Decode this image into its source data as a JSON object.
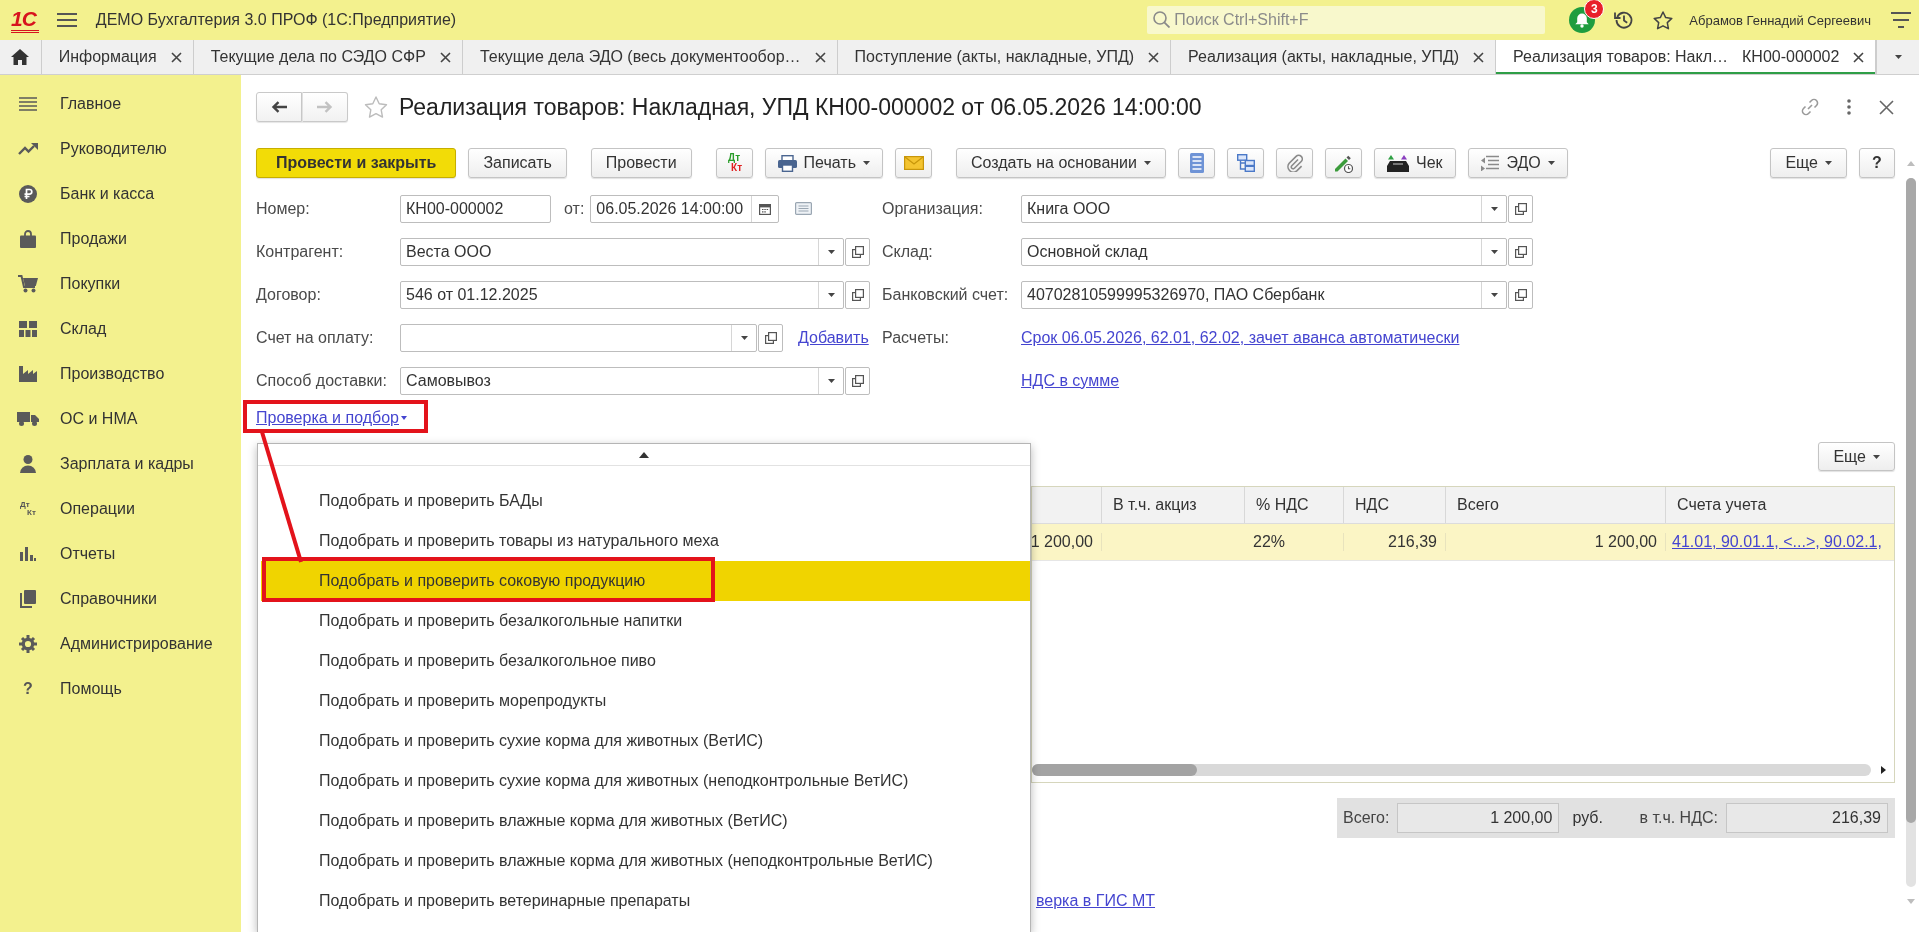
{
  "app_bar": {
    "logo": "1С",
    "title": "ДЕМО Бухгалтерия 3.0 ПРОФ (1С:Предприятие)",
    "search": {
      "placeholder": "Поиск Ctrl+Shift+F"
    },
    "notifications": "3",
    "user": "Абрамов Геннадий Сергеевич"
  },
  "tabs": [
    {
      "label": "Информация",
      "selected": false
    },
    {
      "label": "Текущие дела по СЭДО СФР",
      "selected": false
    },
    {
      "label": "Текущие дела ЭДО (весь документообор…",
      "selected": false
    },
    {
      "label": "Поступление (акты, накладные, УПД)",
      "selected": false
    },
    {
      "label": "Реализация (акты, накладные, УПД)",
      "selected": false
    },
    {
      "label": "Реализация товаров: Накл…",
      "number": "КН00-000002",
      "selected": true
    }
  ],
  "sidebar": {
    "items": [
      {
        "label": "Главное"
      },
      {
        "label": "Руководителю"
      },
      {
        "label": "Банк и касса"
      },
      {
        "label": "Продажи"
      },
      {
        "label": "Покупки"
      },
      {
        "label": "Склад"
      },
      {
        "label": "Производство"
      },
      {
        "label": "ОС и НМА"
      },
      {
        "label": "Зарплата и кадры"
      },
      {
        "label": "Операции",
        "icon_text": [
          "Дт",
          "Кт"
        ]
      },
      {
        "label": "Отчеты"
      },
      {
        "label": "Справочники"
      },
      {
        "label": "Администрирование"
      },
      {
        "label": "Помощь",
        "icon_text": [
          "?"
        ]
      }
    ]
  },
  "document": {
    "title": "Реализация товаров: Накладная, УПД КН00-000002 от 06.05.2026 14:00:00",
    "navigation": {
      "back": {
        "disabled": false
      },
      "forward": {
        "disabled": true
      }
    },
    "toolbar": {
      "groups": [
        [
          {
            "kind": "primary",
            "label": "Провести и закрыть"
          },
          {
            "kind": "text",
            "label": "Записать"
          }
        ],
        [
          {
            "kind": "text",
            "label": "Провести"
          }
        ],
        [
          {
            "kind": "dtkt",
            "top": "Дт",
            "bottom": "Кт"
          },
          {
            "kind": "menu",
            "label": "Печать"
          },
          {
            "kind": "icon"
          }
        ],
        [
          {
            "kind": "menu",
            "label": "Создать на основании"
          },
          {
            "kind": "icon"
          },
          {
            "kind": "icon"
          },
          {
            "kind": "icon"
          },
          {
            "kind": "icon"
          },
          {
            "kind": "text",
            "label": "Чек"
          },
          {
            "kind": "menu",
            "label": "ЭДО"
          }
        ]
      ],
      "right": [
        {
          "kind": "menu",
          "label": "Еще"
        },
        {
          "kind": "help",
          "label": "?"
        }
      ]
    },
    "form": {
      "left": [
        {
          "label": "Номер:",
          "kind": "number",
          "value": "КН00-000002",
          "date_label": "от:",
          "date": "06.05.2026 14:00:00"
        },
        {
          "label": "Контрагент:",
          "kind": "select",
          "value": "Веста ООО"
        },
        {
          "label": "Договор:",
          "kind": "select",
          "value": "546 от 01.12.2025"
        },
        {
          "label": "Счет на оплату:",
          "kind": "select_short",
          "link": "Добавить"
        },
        {
          "label": "Способ доставки:",
          "kind": "select",
          "value": "Самовывоз"
        }
      ],
      "right": [
        {
          "label": "Организация:",
          "kind": "select",
          "value": "Книга ООО"
        },
        {
          "label": "Склад:",
          "kind": "select",
          "value": "Основной склад"
        },
        {
          "label": "Банковский счет:",
          "kind": "select",
          "value": "40702810599995326970, ПАО Сбербанк"
        },
        {
          "label": "Расчеты:",
          "kind": "link",
          "value": "Срок 06.05.2026, 62.01, 62.02, зачет аванса автоматически"
        },
        {
          "kind": "link",
          "value": "НДС в сумме"
        }
      ]
    },
    "check_menu": {
      "label": "Проверка и подбор",
      "expanded": true,
      "items": [
        {
          "label": "Подобрать и проверить БАДы",
          "selected": false
        },
        {
          "label": "Подобрать и проверить товары из натурального меха",
          "selected": false
        },
        {
          "label": "Подобрать и проверить соковую продукцию",
          "selected": true
        },
        {
          "label": "Подобрать и проверить безалкогольные напитки",
          "selected": false
        },
        {
          "label": "Подобрать и проверить безалкогольное пиво",
          "selected": false
        },
        {
          "label": "Подобрать и проверить морепродукты",
          "selected": false
        },
        {
          "label": "Подобрать и проверить сухие корма для животных (ВетИС)",
          "selected": false
        },
        {
          "label": "Подобрать и проверить сухие корма для животных (неподконтрольные ВетИС)",
          "selected": false
        },
        {
          "label": "Подобрать и проверить влажные корма для животных (ВетИС)",
          "selected": false
        },
        {
          "label": "Подобрать и проверить влажные корма для животных (неподконтрольные ВетИС)",
          "selected": false
        },
        {
          "label": "Подобрать и проверить ветеринарные препараты",
          "selected": false
        }
      ]
    },
    "table": {
      "more": "Еще",
      "columns": [
        {
          "kind": "number"
        },
        {
          "label": "В т.ч. акциз",
          "kind": "number"
        },
        {
          "label": "% НДС",
          "kind": "text"
        },
        {
          "label": "НДС",
          "kind": "number"
        },
        {
          "label": "Всего",
          "kind": "number"
        },
        {
          "label": "Счета учета",
          "kind": "link"
        }
      ],
      "rows": [
        {
          "selected": true,
          "cells": [
            "1 200,00",
            null,
            "22%",
            "216,39",
            "1 200,00",
            "41.01, 90.01.1, <...>, 90.02.1,"
          ]
        }
      ]
    },
    "totals": {
      "total_label": "Всего:",
      "total": "1 200,00",
      "currency": "руб.",
      "vat_label": "в т.ч. НДС:",
      "vat": "216,39"
    },
    "footer_link": "верка в ГИС МТ"
  }
}
